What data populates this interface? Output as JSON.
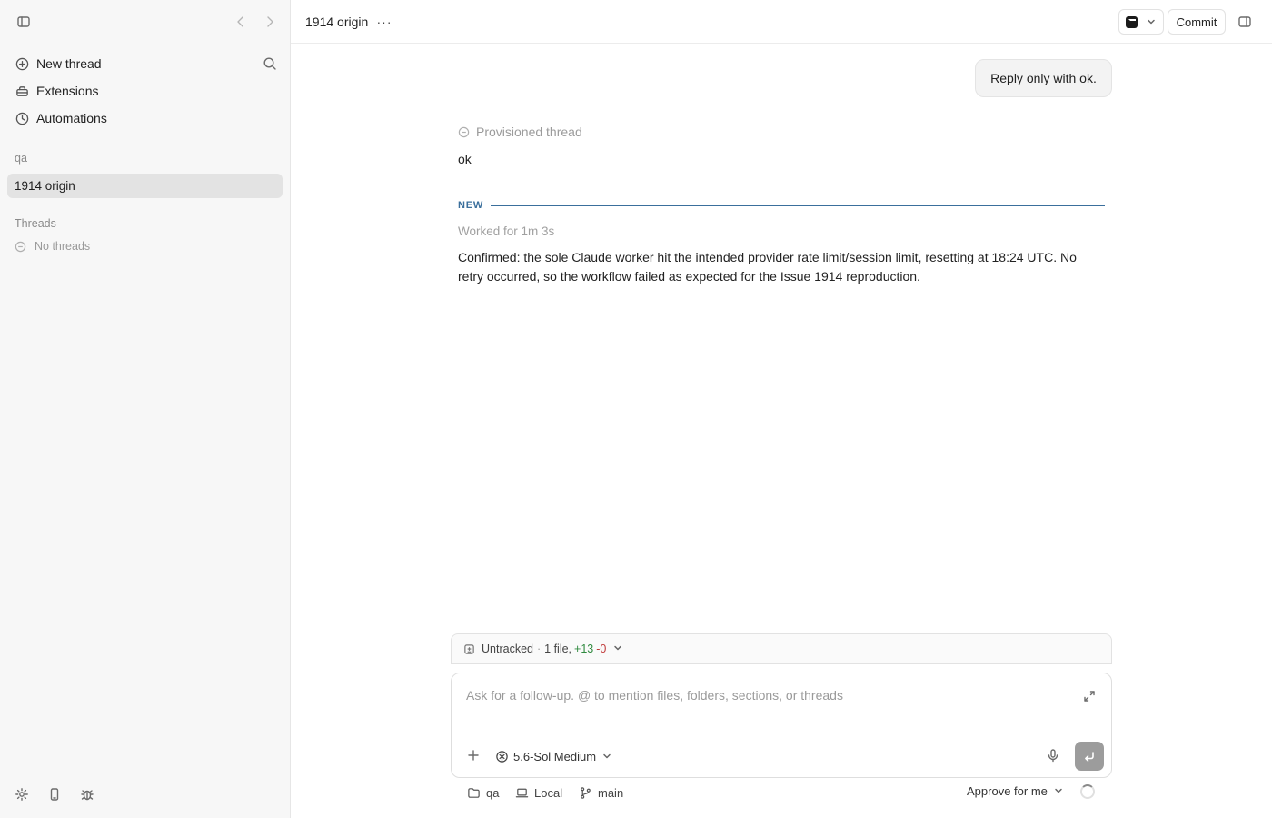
{
  "sidebar": {
    "nav": [
      {
        "label": "New thread",
        "icon": "plus-circle-icon"
      },
      {
        "label": "Extensions",
        "icon": "extensions-icon"
      },
      {
        "label": "Automations",
        "icon": "clock-icon"
      }
    ],
    "project_label": "qa",
    "active_thread": "1914 origin",
    "threads_label": "Threads",
    "no_threads": "No threads"
  },
  "header": {
    "title": "1914 origin",
    "commit_label": "Commit"
  },
  "conversation": {
    "user_message": "Reply only with ok.",
    "provisioned_label": "Provisioned thread",
    "reply": "ok",
    "new_label": "NEW",
    "worked_for": "Worked for 1m 3s",
    "answer": "Confirmed: the sole Claude worker hit the intended provider rate limit/session limit, resetting at 18:24 UTC. No retry occurred, so the workflow failed as expected for the Issue 1914 reproduction."
  },
  "changes": {
    "status": "Untracked",
    "files": "1 file,",
    "additions": "+13",
    "deletions": "-0"
  },
  "composer": {
    "placeholder": "Ask for a follow-up. @ to mention files, folders, sections, or threads",
    "model": "5.6-Sol Medium"
  },
  "footer": {
    "project": "qa",
    "environment": "Local",
    "branch": "main",
    "approval": "Approve for me"
  },
  "colors": {
    "accent_new": "#3a6f9c",
    "additions": "#2f8a3f",
    "deletions": "#c03a3a",
    "sidebar_bg": "#f7f7f7",
    "active_item_bg": "#e3e3e3"
  }
}
